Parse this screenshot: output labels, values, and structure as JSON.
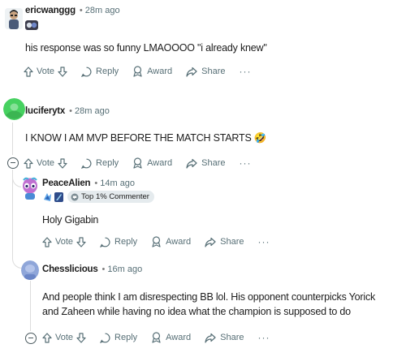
{
  "actions": {
    "vote": "Vote",
    "reply": "Reply",
    "award": "Award",
    "share": "Share",
    "more": "···"
  },
  "comments": [
    {
      "author": "ericwanggg",
      "time": "28m ago",
      "text": "his response was so funny LMAOOOO \"i already knew\""
    },
    {
      "author": "luciferytx",
      "time": "28m ago",
      "text": "I KNOW I AM MVP BEFORE THE MATCH STARTS 🤣"
    },
    {
      "author": "PeaceAlien",
      "time": "14m ago",
      "badge": "Top 1% Commenter",
      "text": "Holy Gigabin"
    },
    {
      "author": "Chesslicious",
      "time": "16m ago",
      "text": "And people think I am disrespecting BB lol. His opponent counterpicks Yorick and Zaheen while having no idea what the champion is supposed to do"
    }
  ],
  "colors": {
    "meta_gray": "#576f76",
    "thread_line": "#dcdcdc",
    "badge_bg": "#e5ebee",
    "avatar_green": "#46d160"
  }
}
